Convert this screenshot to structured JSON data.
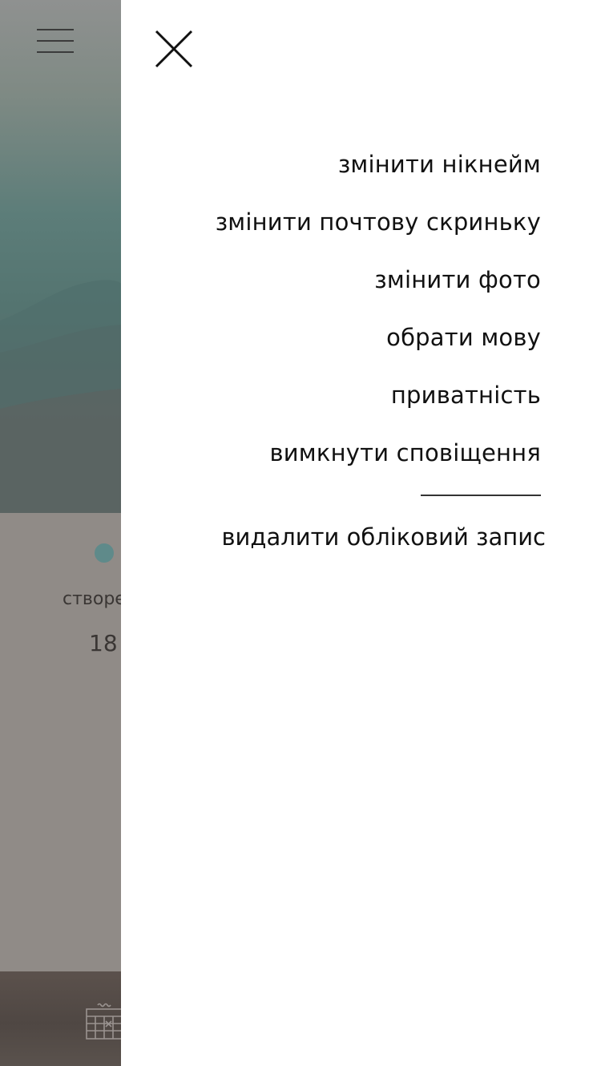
{
  "background_page": {
    "menu_icon": "hamburger-menu-icon",
    "status_color": "#5f8a8a",
    "created_label": "створе",
    "created_value": "18",
    "calendar_icon": "calendar-icon"
  },
  "drawer": {
    "close_icon": "close-icon",
    "items": [
      {
        "label": "змінити нікнейм"
      },
      {
        "label": "змінити почтову скриньку"
      },
      {
        "label": "змінити фото"
      },
      {
        "label": "обрати мову"
      },
      {
        "label": "приватність"
      },
      {
        "label": "вимкнути сповіщення"
      }
    ],
    "delete_account_label": "видалити обліковий запис"
  },
  "colors": {
    "drawer_background": "#ffffff",
    "overlay_tint": "#908b87",
    "text": "#111111"
  }
}
